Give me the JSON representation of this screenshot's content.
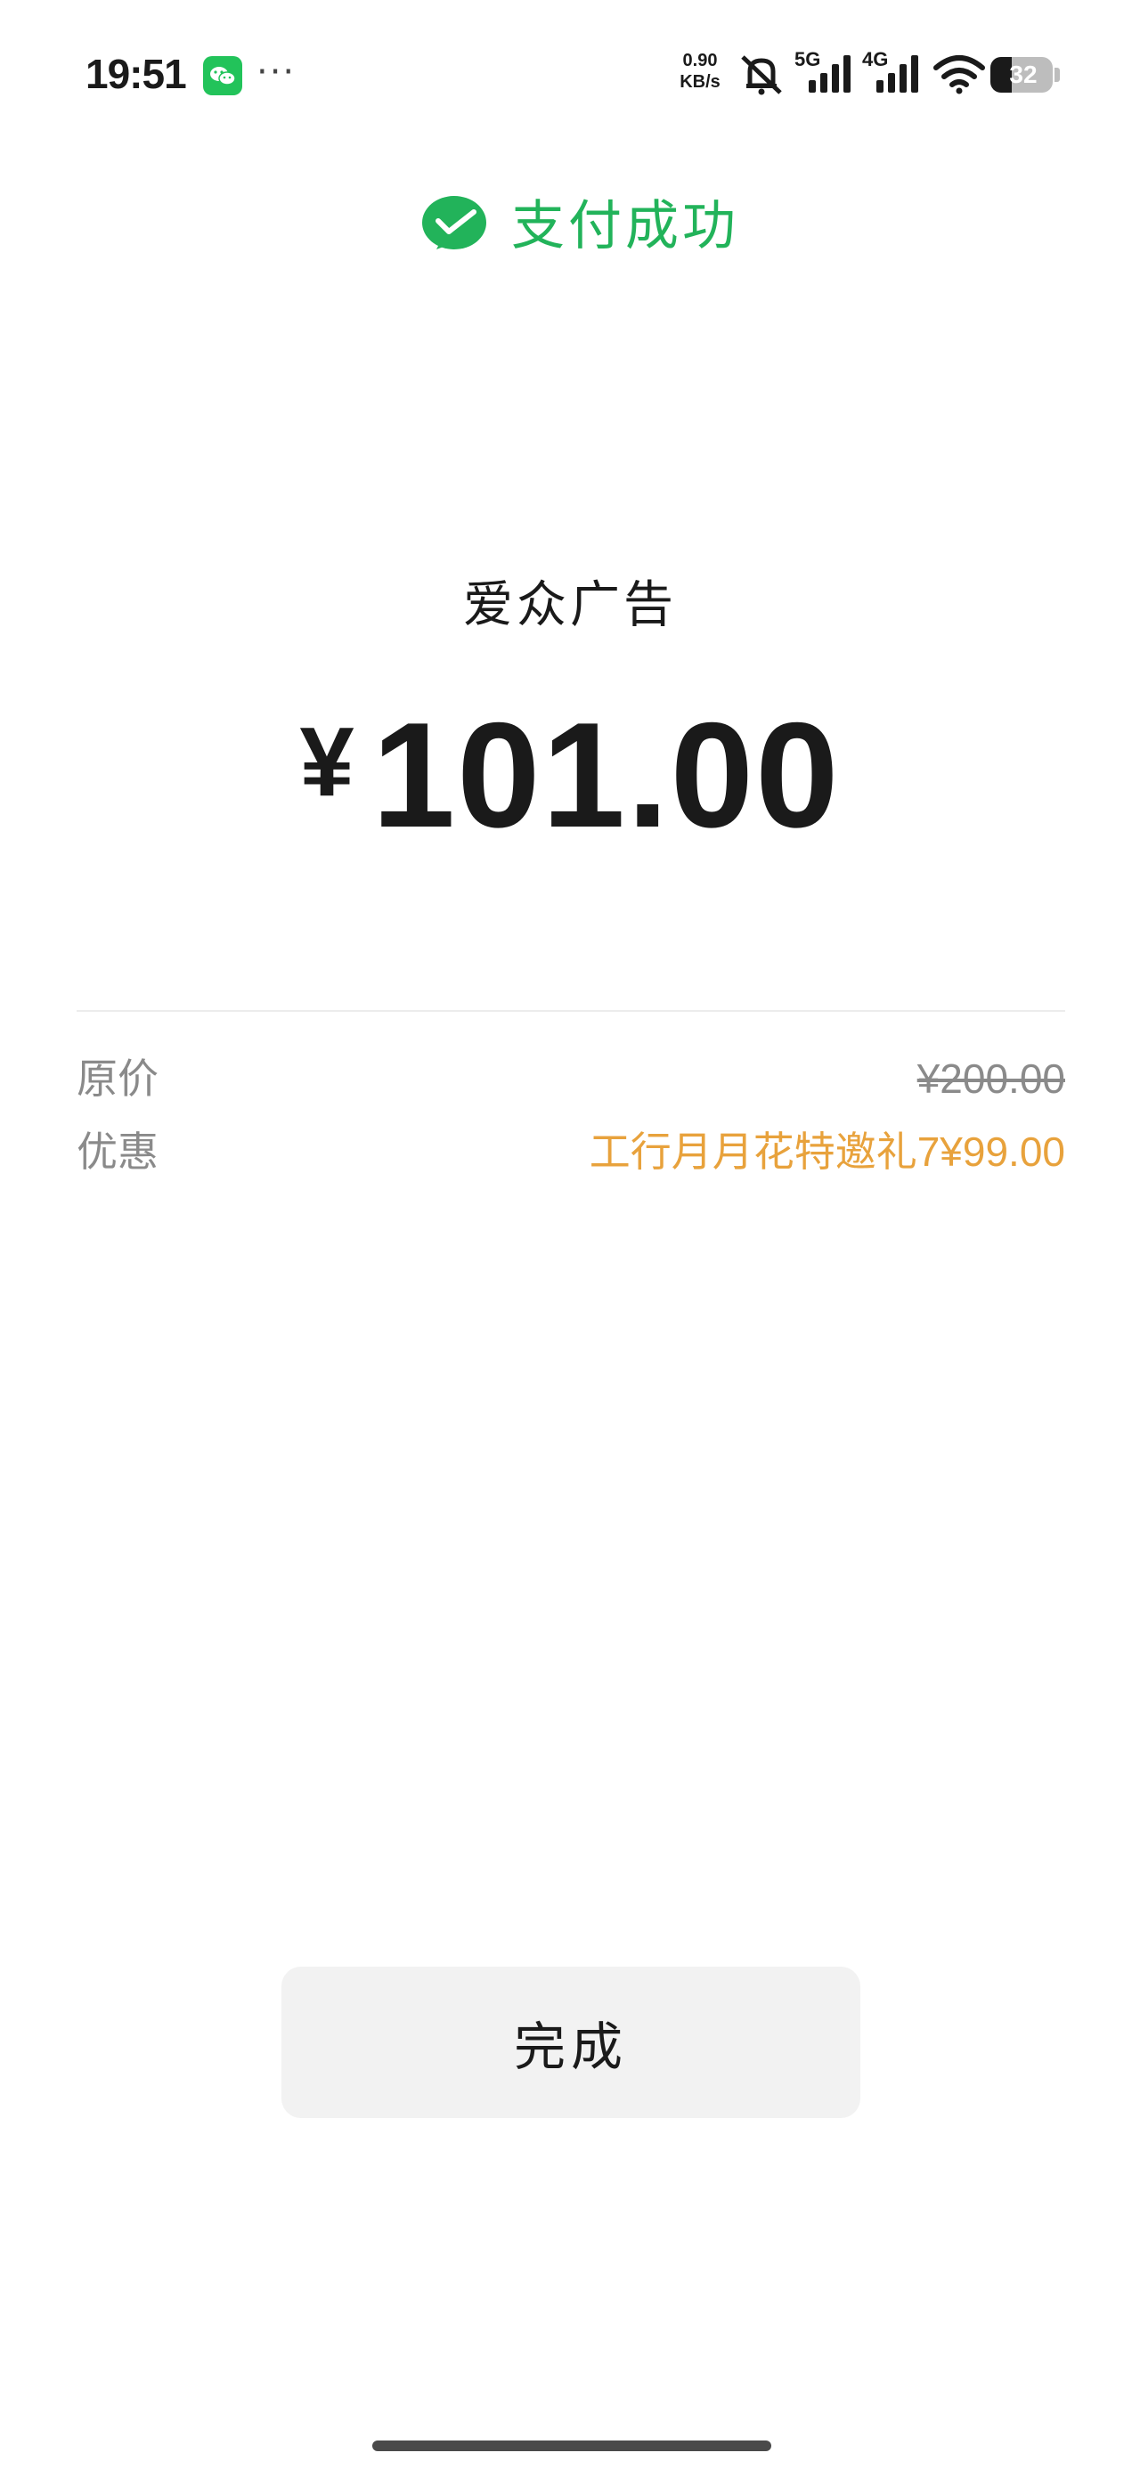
{
  "status_bar": {
    "time": "19:51",
    "more": "···",
    "net_speed_value": "0.90",
    "net_speed_unit": "KB/s",
    "network_1": "5G",
    "network_2": "4G",
    "battery": "32",
    "icons": [
      "wechat-icon",
      "mute-icon",
      "signal-icon",
      "wifi-icon",
      "battery-icon"
    ]
  },
  "header": {
    "icon": "wechat-pay-check-icon",
    "title": "支付成功",
    "accent_color": "#22b35a"
  },
  "payment": {
    "merchant": "爱众广告",
    "currency": "¥",
    "amount": "101.00"
  },
  "details": [
    {
      "label": "原价",
      "value": "¥200.00"
    },
    {
      "label": "优惠",
      "value": "工行月月花特邀礼7¥99.00"
    }
  ],
  "discount_color": "#e8a23c",
  "done_button": {
    "label": "完成"
  }
}
